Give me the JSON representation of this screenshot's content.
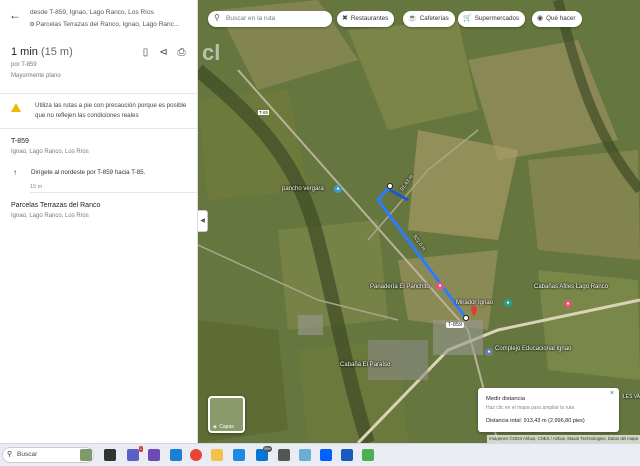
{
  "panel": {
    "from_prefix": "desde ",
    "from_place": "T-859, Ignao, Lago Ranco, Los Ríos",
    "to_place": "Parcelas Terrazas del Ranco, Ignao, Lago Ranc...",
    "time": "1 min",
    "distance": "(15 m)",
    "via": "por T-859",
    "terrain": "Mayormente plano",
    "warning": "Utiliza las rutas a pie con precaución porque es posible que no reflejen las condiciones reales",
    "origin_title": "T-859",
    "origin_sub": "Ignao, Lago Ranco, Los Ríos",
    "direction": "Dirígete al nordeste por T-859 hacia T-85.",
    "direction_dist": "15 m",
    "dest_title": "Parcelas Terrazas del Ranco",
    "dest_sub": "Ignao, Lago Ranco, Los Ríos"
  },
  "map": {
    "search_placeholder": "Buscar en la ruta",
    "chips": [
      "Restaurantes",
      "Cafeterías",
      "Supermercados",
      "Qué hacer"
    ],
    "watermark": "cl",
    "pois": {
      "rancho": "pancho vergara",
      "panaderia": "Panadería El Panchito",
      "mirador": "Mirador Ignao",
      "cabanas": "Cabañas Afiles Lago Ranco",
      "complejo": "Complejo Educacional Ignao",
      "cabana_paraiso": "Cabaña El Paraíso",
      "road_label": "T-859",
      "road_tag": "T-85",
      "route_dist_1": "91.43 m",
      "route_dist_2": "822.0 m",
      "edge_label": "LES VAL (AGC"
    },
    "layers_label": "Capas",
    "measure": {
      "title": "Medir distancia",
      "hint": "Haz clic en el mapa para ampliar la ruta",
      "total": "Distancia total: 913,43 m (2.996,80 pies)",
      "close": "×"
    },
    "attribution": "Imágenes ©2024 Airbus, CNES / Airbus, Maxar Technologies, Datos del mapa"
  },
  "taskbar": {
    "search": "Buscar",
    "badge": "1",
    "badge2": "99+"
  }
}
